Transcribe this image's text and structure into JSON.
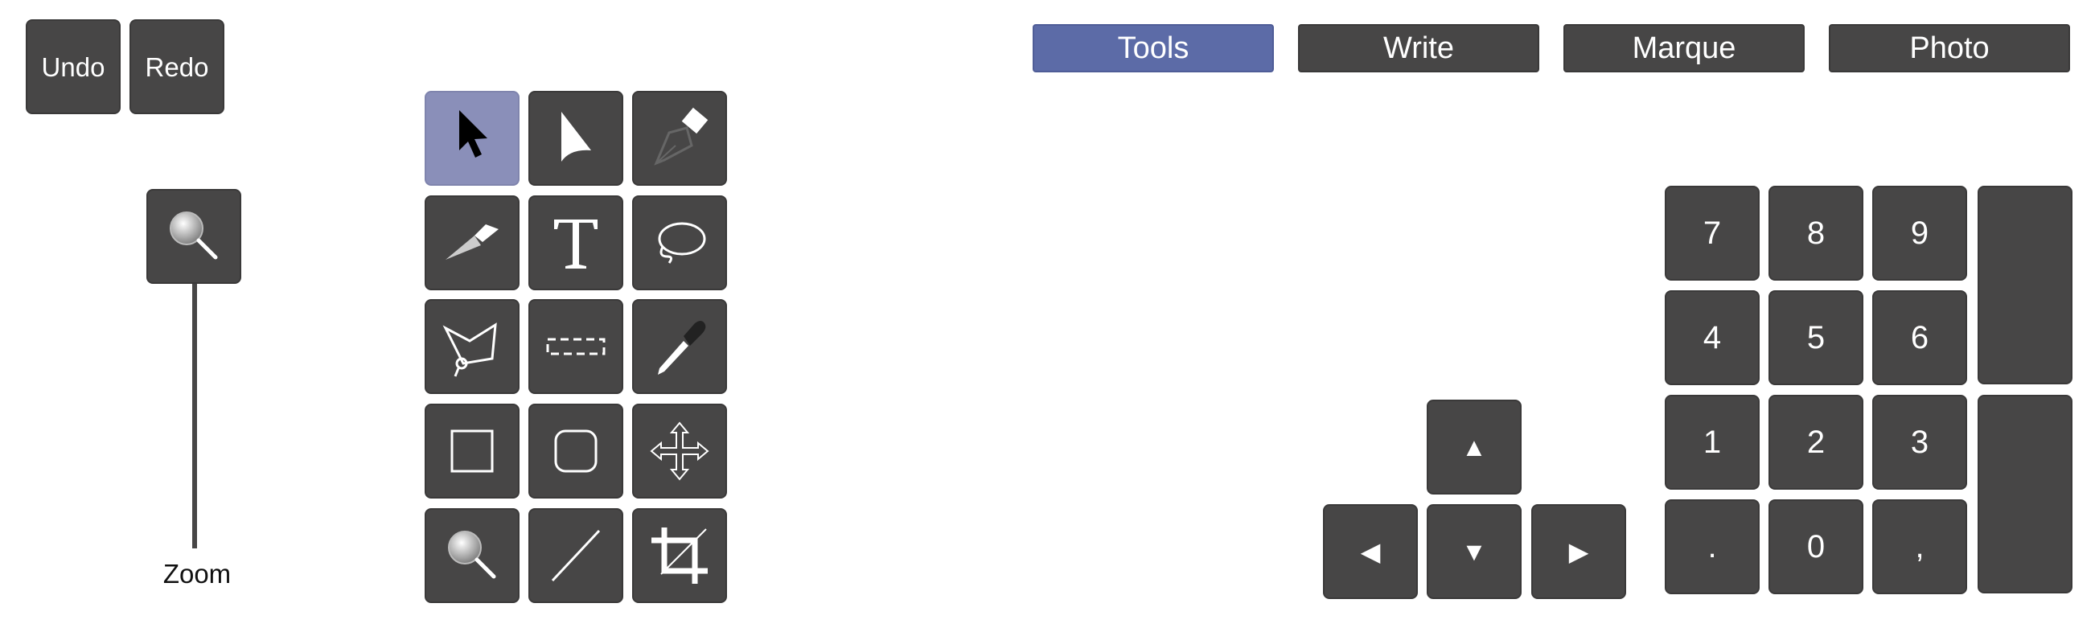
{
  "edit": {
    "undo_label": "Undo",
    "redo_label": "Redo"
  },
  "zoom": {
    "label": "Zoom",
    "handle_icon": "magnifier-icon"
  },
  "tabs": [
    {
      "label": "Tools",
      "active": true
    },
    {
      "label": "Write",
      "active": false
    },
    {
      "label": "Marque",
      "active": false
    },
    {
      "label": "Photo",
      "active": false
    }
  ],
  "tools": [
    {
      "icon": "selection-arrow-icon",
      "selected": true
    },
    {
      "icon": "direct-selection-icon",
      "selected": false
    },
    {
      "icon": "pen-nib-icon",
      "selected": false
    },
    {
      "icon": "knife-icon",
      "selected": false
    },
    {
      "icon": "text-icon",
      "selected": false
    },
    {
      "icon": "lasso-icon",
      "selected": false
    },
    {
      "icon": "polygon-lasso-icon",
      "selected": false
    },
    {
      "icon": "marquee-icon",
      "selected": false
    },
    {
      "icon": "eyedropper-icon",
      "selected": false
    },
    {
      "icon": "rectangle-icon",
      "selected": false
    },
    {
      "icon": "rounded-rectangle-icon",
      "selected": false
    },
    {
      "icon": "move-icon",
      "selected": false
    },
    {
      "icon": "zoom-icon",
      "selected": false
    },
    {
      "icon": "line-icon",
      "selected": false
    },
    {
      "icon": "crop-icon",
      "selected": false
    }
  ],
  "keypad": {
    "keys": [
      "7",
      "8",
      "9",
      "4",
      "5",
      "6",
      "1",
      "2",
      "3",
      ".",
      "0",
      ","
    ]
  },
  "arrows": {
    "up": "▲",
    "left": "◀",
    "down": "▼",
    "right": "▶"
  },
  "colors": {
    "button": "#474646",
    "active_tab": "#5c6ba7",
    "selected_tool": "#8a8fb9"
  }
}
